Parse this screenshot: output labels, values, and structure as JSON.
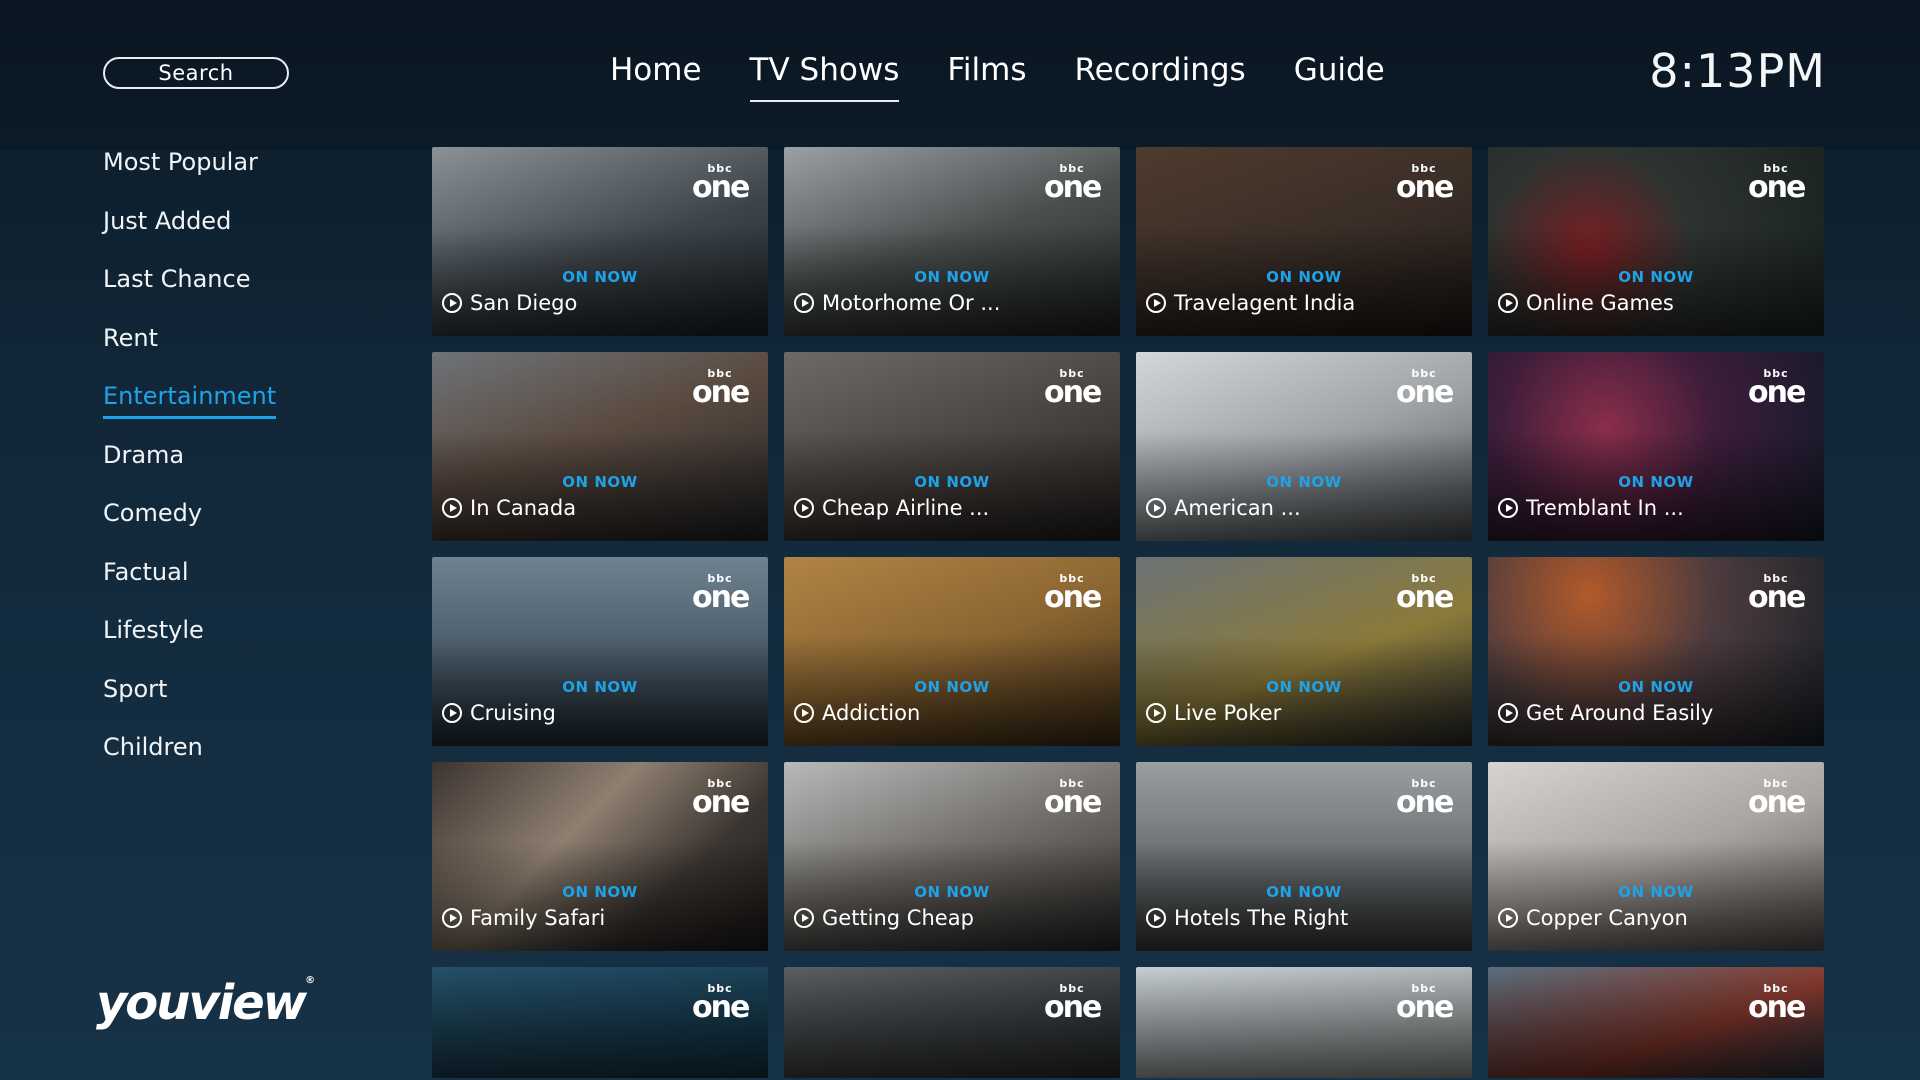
{
  "header": {
    "search_label": "Search",
    "nav": [
      "Home",
      "TV Shows",
      "Films",
      "Recordings",
      "Guide"
    ],
    "active_nav": "TV Shows",
    "clock": "8:13PM"
  },
  "sidebar": {
    "items": [
      "Most Popular",
      "Just Added",
      "Last Chance",
      "Rent",
      "Entertainment",
      "Drama",
      "Comedy",
      "Factual",
      "Lifestyle",
      "Sport",
      "Children"
    ],
    "active": "Entertainment",
    "accent_color": "#1fa3e8"
  },
  "brand": {
    "logo_text": "youview",
    "registered_mark": "®"
  },
  "channel_badge": {
    "top": "bbc",
    "bottom": "one"
  },
  "tiles": [
    {
      "status": "ON NOW",
      "title": "San Diego"
    },
    {
      "status": "ON NOW",
      "title": "Motorhome Or ..."
    },
    {
      "status": "ON NOW",
      "title": "Travelagent India"
    },
    {
      "status": "ON NOW",
      "title": "Online Games"
    },
    {
      "status": "ON NOW",
      "title": "In Canada"
    },
    {
      "status": "ON NOW",
      "title": "Cheap Airline ..."
    },
    {
      "status": "ON NOW",
      "title": "American  ..."
    },
    {
      "status": "ON NOW",
      "title": "Tremblant In ..."
    },
    {
      "status": "ON NOW",
      "title": "Cruising"
    },
    {
      "status": "ON NOW",
      "title": "Addiction"
    },
    {
      "status": "ON NOW",
      "title": "Live Poker"
    },
    {
      "status": "ON NOW",
      "title": "Get Around Easily"
    },
    {
      "status": "ON NOW",
      "title": "Family Safari"
    },
    {
      "status": "ON NOW",
      "title": "Getting Cheap"
    },
    {
      "status": "ON NOW",
      "title": "Hotels The Right"
    },
    {
      "status": "ON NOW",
      "title": "Copper Canyon"
    }
  ]
}
